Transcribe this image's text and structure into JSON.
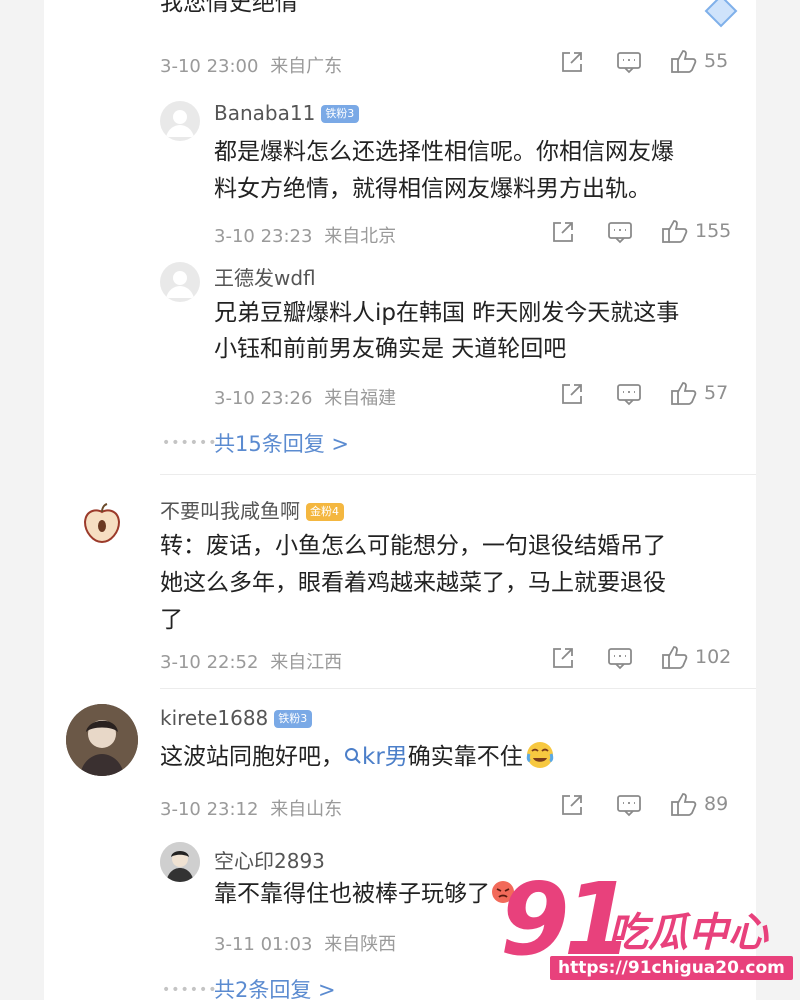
{
  "top_comment": {
    "text_partial": "我您情史绝情",
    "time": "3-10 23:00",
    "location": "来自广东",
    "likes": "55"
  },
  "replies_1": [
    {
      "username": "Banaba11",
      "badge": "铁粉3",
      "lines": [
        "都是爆料怎么还选择性相信呢。你相信网友爆",
        "料女方绝情，就得相信网友爆料男方出轨。"
      ],
      "time": "3-10 23:23",
      "location": "来自北京",
      "likes": "155"
    },
    {
      "username": "王德发wdfl",
      "lines": [
        "兄弟豆瓣爆料人ip在韩国 昨天刚发今天就这事",
        "小钰和前前男友确实是 天道轮回吧"
      ],
      "time": "3-10 23:26",
      "location": "来自福建",
      "likes": "57"
    }
  ],
  "replies_1_more": "共15条回复 >",
  "comment_2": {
    "username": "不要叫我咸鱼啊",
    "badge": "金粉4",
    "lines": [
      "转：废话，小鱼怎么可能想分，一句退役结婚吊了",
      "她这么多年，眼看着鸡越来越菜了，马上就要退役",
      "了"
    ],
    "time": "3-10 22:52",
    "location": "来自江西",
    "likes": "102"
  },
  "comment_3": {
    "username": "kirete1688",
    "badge": "铁粉3",
    "text_before": "这波站同胞好吧，",
    "link_text": "kr男",
    "text_after": "确实靠不住",
    "time": "3-10 23:12",
    "location": "来自山东",
    "likes": "89"
  },
  "replies_3": [
    {
      "username": "空心印2893",
      "text": "靠不靠得住也被棒子玩够了",
      "time": "3-11 01:03",
      "location": "来自陕西"
    }
  ],
  "replies_3_more": "共2条回复 >",
  "icons": {
    "share": "share-icon",
    "comment": "comment-icon",
    "like": "thumbs-up-icon"
  },
  "watermark": {
    "number": "91",
    "name": "吃瓜中心",
    "url": "https://91chigua20.com"
  },
  "colors": {
    "link": "#5b8bd0",
    "watermark": "#e8417c",
    "iron_badge": "#7aa9e6",
    "gold_badge": "#f4b740"
  }
}
